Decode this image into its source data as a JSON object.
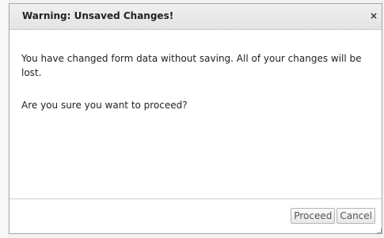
{
  "dialog": {
    "title": "Warning: Unsaved Changes!",
    "close_glyph": "×",
    "message_line": "You have changed form data without saving. All of your changes will be lost.",
    "question": "Are you sure you want to proceed?",
    "buttons": {
      "proceed": "Proceed",
      "cancel": "Cancel"
    }
  }
}
